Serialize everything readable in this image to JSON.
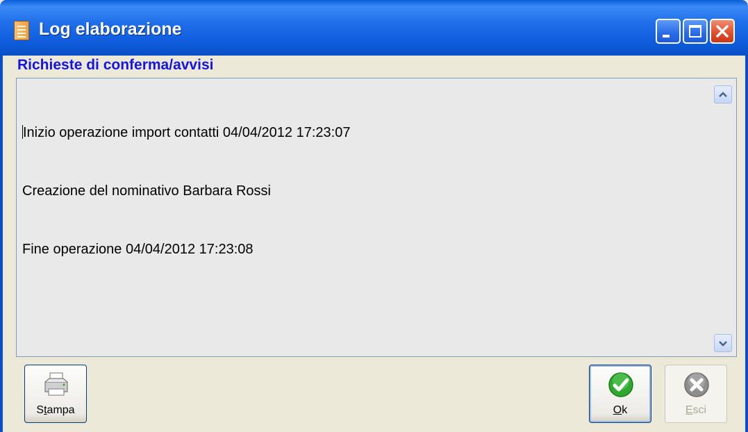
{
  "window": {
    "title": "Log elaborazione",
    "controls": [
      "minimize-icon",
      "maximize-icon",
      "close-icon"
    ]
  },
  "section": {
    "label": "Richieste di conferma/avvisi"
  },
  "log": {
    "lines": [
      "Inizio operazione import contatti 04/04/2012 17:23:07",
      "Creazione del nominativo Barbara Rossi",
      "Fine operazione 04/04/2012 17:23:08"
    ]
  },
  "buttons": {
    "stampa": {
      "label_before": "S",
      "label_underlined": "t",
      "label_after": "ampa",
      "icon": "printer-icon"
    },
    "ok": {
      "label_before": "",
      "label_underlined": "O",
      "label_after": "k",
      "icon": "check-icon"
    },
    "esci": {
      "label_before": "",
      "label_underlined": "E",
      "label_after": "sci",
      "icon": "cancel-icon",
      "enabled": false
    }
  },
  "colors": {
    "titlebar": "#1f6fea",
    "section_label": "#1414e6",
    "window_bg": "#ece9d8",
    "ok_icon": "#2fa82f",
    "close_button": "#e05030"
  }
}
